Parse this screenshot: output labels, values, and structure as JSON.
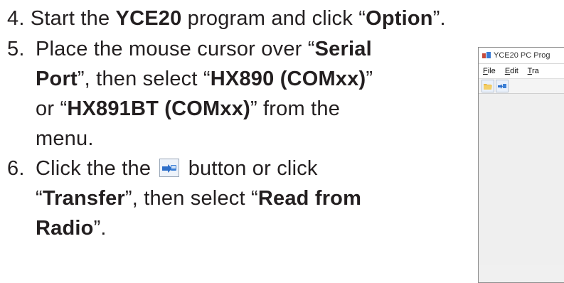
{
  "steps": [
    {
      "number": "4.",
      "lines": [
        [
          "Start the ",
          {
            "b": "YCE20"
          },
          " program and click “",
          {
            "b": "Option"
          },
          "”."
        ]
      ]
    },
    {
      "number": "5.",
      "lines": [
        [
          "Place the mouse cursor over “",
          {
            "b": "Serial"
          }
        ],
        [
          {
            "b": "Port"
          },
          "”, then select “",
          {
            "b": "HX890 (COMxx)"
          },
          "”"
        ],
        [
          "or “",
          {
            "b": "HX891BT (COMxx)"
          },
          "” from the"
        ],
        [
          "menu."
        ]
      ]
    },
    {
      "number": "6.",
      "lines": [
        [
          "Click the the ",
          {
            "icon": "transfer-icon"
          },
          " button or click"
        ],
        [
          "“",
          {
            "b": "Transfer"
          },
          "”, then select “",
          {
            "b": "Read from"
          }
        ],
        [
          {
            "b": "Radio"
          },
          "”."
        ]
      ]
    }
  ],
  "app": {
    "title": "YCE20 PC Prog",
    "menus": [
      {
        "label": "File",
        "underline": "F"
      },
      {
        "label": "Edit",
        "underline": "E"
      },
      {
        "label": "Tra",
        "underline": "T"
      }
    ],
    "toolbar_icons": [
      "open-folder-icon",
      "transfer-icon"
    ]
  }
}
